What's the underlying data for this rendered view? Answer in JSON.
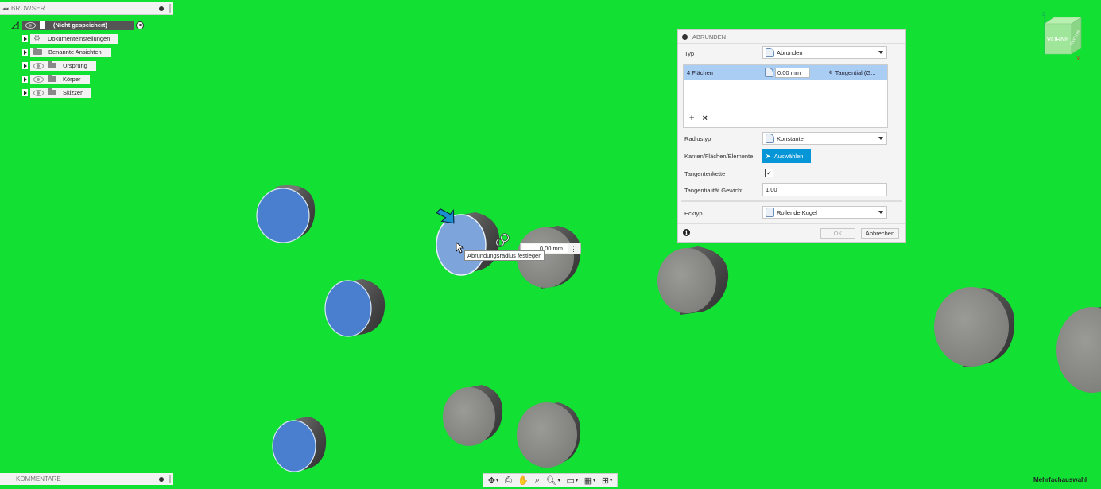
{
  "browser": {
    "title": "BROWSER",
    "root_label": "(Nicht gespeichert)",
    "items": [
      {
        "label": "Dokumenteinstellungen",
        "icon": "gear-icon"
      },
      {
        "label": "Benannte Ansichten",
        "icon": "folder-icon"
      },
      {
        "label": "Ursprung",
        "icon": "folder-icon"
      },
      {
        "label": "Körper",
        "icon": "folder-icon"
      },
      {
        "label": "Skizzen",
        "icon": "folder-icon"
      }
    ]
  },
  "comments": {
    "title": "KOMMENTARE"
  },
  "dialog": {
    "title": "ABRUNDEN",
    "typ_label": "Typ",
    "typ_value": "Abrunden",
    "selection": {
      "name": "4 Flächen",
      "radius": "0.00 mm",
      "tangent": "Tangential (G..."
    },
    "plus": "+",
    "remove": "×",
    "radiustyp_label": "Radiustyp",
    "radiustyp_value": "Konstante",
    "kanten_label": "Kanten/Flächen/Elemente",
    "select_button": "Auswählen",
    "tangentenkette_label": "Tangentenkette",
    "tangentenkette_check": "✓",
    "tangentialitaet_label": "Tangentialität Gewicht",
    "tangentialitaet_value": "1.00",
    "ecktyp_label": "Ecktyp",
    "ecktyp_value": "Rollende Kugel",
    "info": "i",
    "ok": "OK",
    "cancel": "Abbrechen"
  },
  "canvas": {
    "value_input": "0.00 mm",
    "more": "⋮",
    "tooltip": "Abrundungsradius festlegen"
  },
  "viewcube": {
    "face_front": "VORNE",
    "face_right": "RECHTS",
    "axis_z": "Z",
    "axis_x": "X"
  },
  "status": {
    "mode": "Mehrfachauswahl"
  },
  "colors": {
    "background": "#12e033",
    "selected_face": "#4a7fd0",
    "highlight_face": "#7ea4dc",
    "body": "#8a8a86",
    "accent": "#0696d7"
  }
}
